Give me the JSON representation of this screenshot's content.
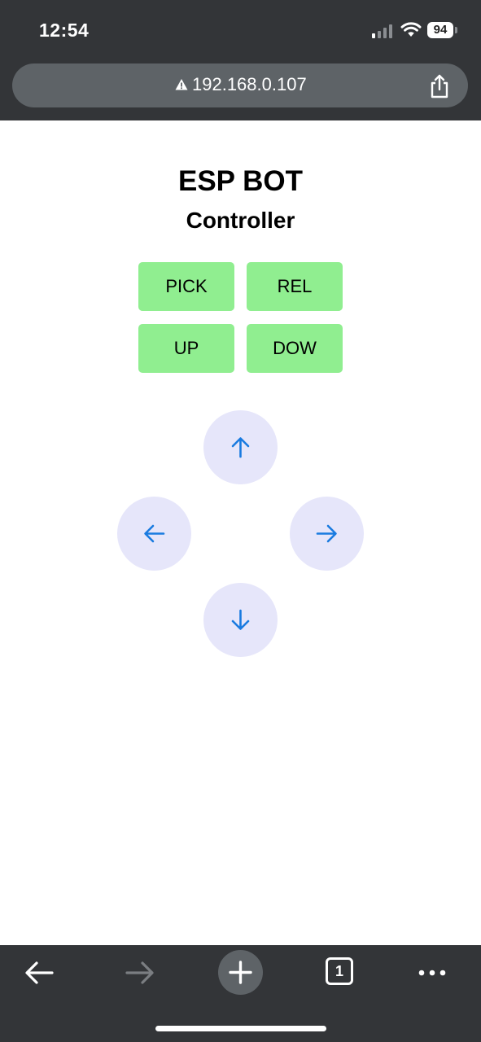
{
  "status_bar": {
    "time": "12:54",
    "battery_level": "94"
  },
  "browser": {
    "url": "192.168.0.107",
    "tab_count": "1",
    "icons": {
      "warning": "warning-icon",
      "share": "share-icon",
      "back": "back-arrow-icon",
      "forward": "forward-arrow-icon",
      "new_tab": "plus-icon",
      "tabs": "tabs-icon",
      "more": "more-icon"
    }
  },
  "page": {
    "title": "ESP BOT",
    "subtitle": "Controller",
    "action_buttons": [
      {
        "label": "PICK"
      },
      {
        "label": "REL"
      },
      {
        "label": "UP"
      },
      {
        "label": "DOW"
      }
    ],
    "direction_pad": {
      "up": "arrow-up-icon",
      "left": "arrow-left-icon",
      "right": "arrow-right-icon",
      "down": "arrow-down-icon"
    },
    "colors": {
      "action_button_bg": "#90ee90",
      "direction_button_bg": "#e6e6fa",
      "arrow_color": "#1a7be0",
      "chrome_bg": "#333538"
    }
  }
}
